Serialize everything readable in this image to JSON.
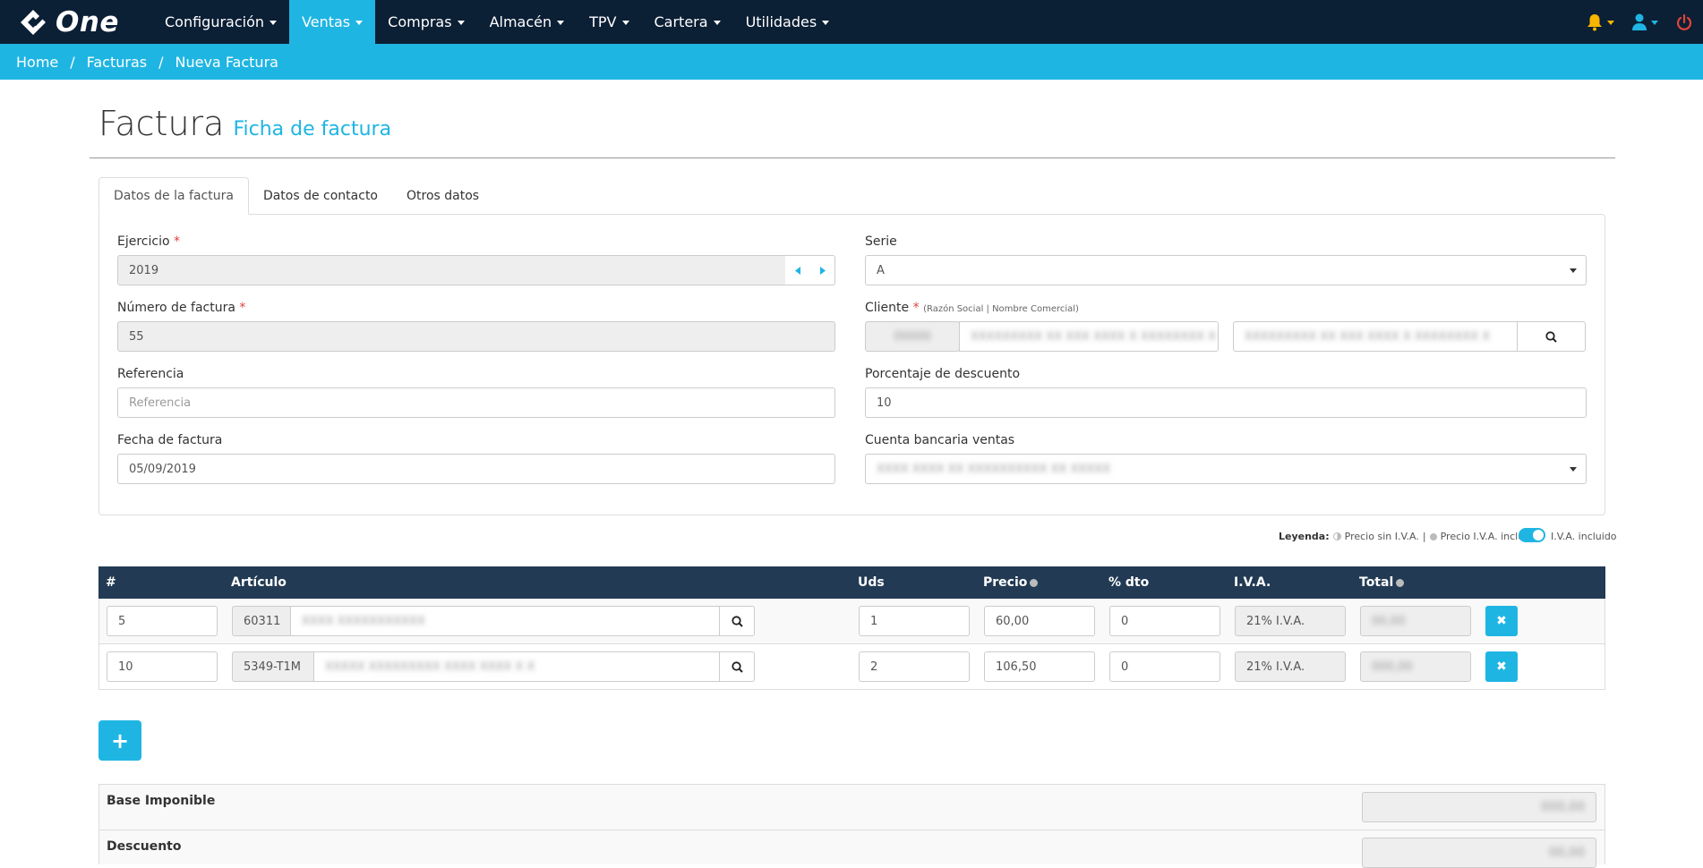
{
  "app": {
    "brand": "One"
  },
  "nav": {
    "menu": [
      "Configuración",
      "Ventas",
      "Compras",
      "Almacén",
      "TPV",
      "Cartera",
      "Utilidades"
    ],
    "active": "Ventas"
  },
  "breadcrumb": [
    "Home",
    "Facturas",
    "Nueva Factura"
  ],
  "header": {
    "title": "Factura",
    "subtitle": "Ficha de factura"
  },
  "tabs": [
    "Datos de la factura",
    "Datos de contacto",
    "Otros datos"
  ],
  "form": {
    "ejercicio": {
      "label": "Ejercicio",
      "value": "2019"
    },
    "numero": {
      "label": "Número de factura",
      "value": "55"
    },
    "referencia": {
      "label": "Referencia",
      "placeholder": "Referencia"
    },
    "fecha": {
      "label": "Fecha de factura",
      "value": "05/09/2019"
    },
    "serie": {
      "label": "Serie",
      "value": "A"
    },
    "cliente": {
      "label": "Cliente",
      "note": "(Razón Social | Nombre Comercial)",
      "code": "00000",
      "name": "XXXXXXXXX XX XXX XXXX X XXXXXXXX X",
      "alt": "XXXXXXXXX XX XXX XXXX X XXXXXXXX X"
    },
    "descuento": {
      "label": "Porcentaje de descuento",
      "value": "10"
    },
    "cuenta": {
      "label": "Cuenta bancaria ventas",
      "value": "XXXX XXXX XX XXXXXXXXXX XX XXXXX"
    }
  },
  "legend": {
    "title": "Leyenda:",
    "sin_iva": "Precio sin I.V.A.",
    "con_iva": "Precio I.V.A. incluido",
    "toggle_label": "I.V.A. incluido"
  },
  "table": {
    "columns": [
      "#",
      "Artículo",
      "Uds",
      "Precio",
      "% dto",
      "I.V.A.",
      "Total"
    ],
    "rows": [
      {
        "num": "5",
        "code": "60311",
        "desc": "XXXX XXXXXXXXXXX",
        "uds": "1",
        "precio": "60,00",
        "dto": "0",
        "iva": "21% I.V.A.",
        "total": "00,00"
      },
      {
        "num": "10",
        "code": "5349-T1M",
        "desc": "XXXXX XXXXXXXXX XXXX XXXX X X",
        "uds": "2",
        "precio": "106,50",
        "dto": "0",
        "iva": "21% I.V.A.",
        "total": "000,00"
      }
    ]
  },
  "totals": {
    "base": "Base Imponible",
    "descuento": "Descuento",
    "base_value": "000,00",
    "desc_value": "00,00"
  }
}
